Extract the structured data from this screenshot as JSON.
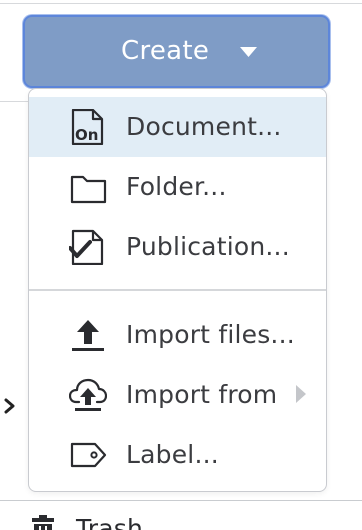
{
  "create_button": {
    "label": "Create",
    "icon": "caret-down-icon"
  },
  "create_menu": {
    "items": [
      {
        "label": "Document...",
        "icon": "document-onshape-icon",
        "highlighted": true
      },
      {
        "label": "Folder...",
        "icon": "folder-icon"
      },
      {
        "label": "Publication...",
        "icon": "publication-icon"
      },
      {
        "label": "Import files...",
        "icon": "upload-icon"
      },
      {
        "label": "Import from",
        "icon": "cloud-upload-icon",
        "has_submenu": true
      },
      {
        "label": "Label...",
        "icon": "tag-icon"
      }
    ],
    "document_icon_text": "On"
  },
  "sidebar": {
    "trash_label": "Trash"
  },
  "colors": {
    "button_bg": "#7f9cc6",
    "button_border": "#5d86da",
    "highlight_bg": "#e1edf6",
    "text": "#3b3c40"
  }
}
